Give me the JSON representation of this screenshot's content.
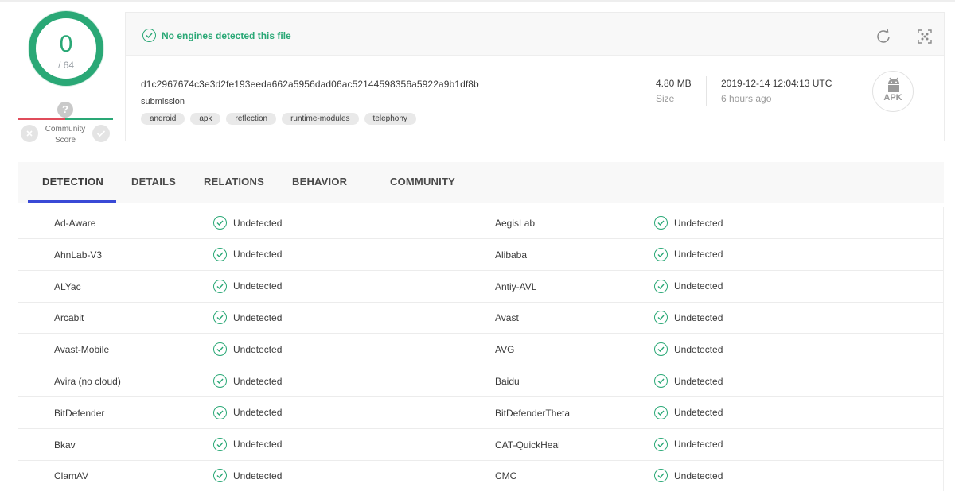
{
  "score": {
    "detections": "0",
    "total": "/ 64",
    "community_label": "Community Score",
    "unknown_icon": "?"
  },
  "summary": {
    "status": "No engines detected this file",
    "hash": "d1c2967674c3e3d2fe193eeda662a5956dad06ac52144598356a5922a9b1df8b",
    "name": "submission",
    "tags": [
      "android",
      "apk",
      "reflection",
      "runtime-modules",
      "telephony"
    ],
    "size_value": "4.80 MB",
    "size_label": "Size",
    "date_value": "2019-12-14 12:04:13 UTC",
    "date_ago": "6 hours ago",
    "file_type": "APK"
  },
  "tabs": [
    {
      "label": "DETECTION",
      "active": true
    },
    {
      "label": "DETAILS"
    },
    {
      "label": "RELATIONS"
    },
    {
      "label": "BEHAVIOR"
    },
    {
      "label": "COMMUNITY"
    }
  ],
  "detections": [
    {
      "left": {
        "engine": "Ad-Aware",
        "result": "Undetected"
      },
      "right": {
        "engine": "AegisLab",
        "result": "Undetected"
      }
    },
    {
      "left": {
        "engine": "AhnLab-V3",
        "result": "Undetected"
      },
      "right": {
        "engine": "Alibaba",
        "result": "Undetected"
      }
    },
    {
      "left": {
        "engine": "ALYac",
        "result": "Undetected"
      },
      "right": {
        "engine": "Antiy-AVL",
        "result": "Undetected"
      }
    },
    {
      "left": {
        "engine": "Arcabit",
        "result": "Undetected"
      },
      "right": {
        "engine": "Avast",
        "result": "Undetected"
      }
    },
    {
      "left": {
        "engine": "Avast-Mobile",
        "result": "Undetected"
      },
      "right": {
        "engine": "AVG",
        "result": "Undetected"
      }
    },
    {
      "left": {
        "engine": "Avira (no cloud)",
        "result": "Undetected"
      },
      "right": {
        "engine": "Baidu",
        "result": "Undetected"
      }
    },
    {
      "left": {
        "engine": "BitDefender",
        "result": "Undetected"
      },
      "right": {
        "engine": "BitDefenderTheta",
        "result": "Undetected"
      }
    },
    {
      "left": {
        "engine": "Bkav",
        "result": "Undetected"
      },
      "right": {
        "engine": "CAT-QuickHeal",
        "result": "Undetected"
      }
    },
    {
      "left": {
        "engine": "ClamAV",
        "result": "Undetected"
      },
      "right": {
        "engine": "CMC",
        "result": "Undetected"
      }
    }
  ],
  "colors": {
    "accent_green": "#2aa876",
    "malicious_red": "#e04c5b",
    "tab_active": "#3949d6"
  },
  "icons": {
    "status": "check-circle-icon",
    "reanalyze": "refresh-icon",
    "similar": "scan-icon",
    "file_type": "android-icon"
  }
}
